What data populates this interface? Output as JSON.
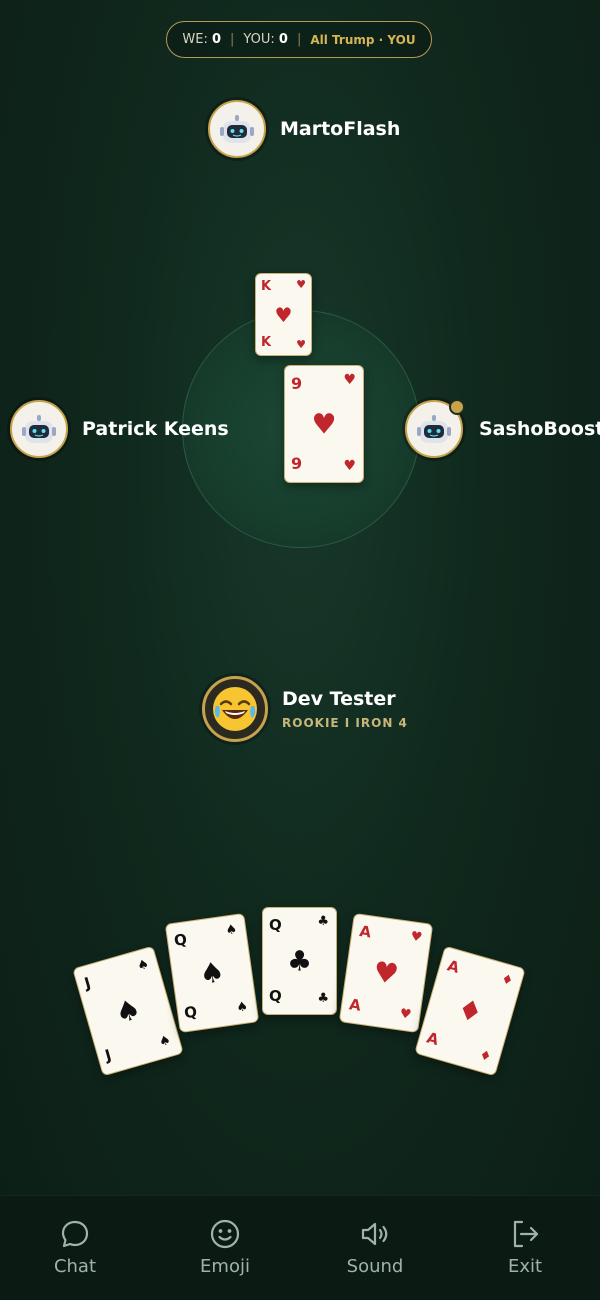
{
  "score": {
    "we_label": "WE:",
    "we_value": "0",
    "separator": "|",
    "you_label": "YOU:",
    "you_value": "0",
    "trump_text": "All Trump · YOU"
  },
  "players": {
    "top": {
      "name": "MartoFlash",
      "avatar": "robot-icon"
    },
    "left": {
      "name": "Patrick Keens",
      "avatar": "robot-icon"
    },
    "right": {
      "name": "SashoBoost",
      "avatar": "robot-icon"
    },
    "me": {
      "name": "Dev Tester",
      "rank": "ROOKIE I IRON 4",
      "avatar": "laughing-emoji-icon"
    }
  },
  "table_cards": [
    {
      "rank": "K",
      "suit": "♥"
    },
    {
      "rank": "9",
      "suit": "♥"
    }
  ],
  "hand": [
    {
      "rank": "J",
      "suit": "♠"
    },
    {
      "rank": "Q",
      "suit": "♠"
    },
    {
      "rank": "Q",
      "suit": "♣"
    },
    {
      "rank": "A",
      "suit": "♥"
    },
    {
      "rank": "A",
      "suit": "♦"
    }
  ],
  "nav": {
    "chat": "Chat",
    "emoji": "Emoji",
    "sound": "Sound",
    "exit": "Exit"
  },
  "colors": {
    "accent_gold": "#c6a24c",
    "felt": "#163a2a",
    "red_suit": "#c0272d"
  }
}
